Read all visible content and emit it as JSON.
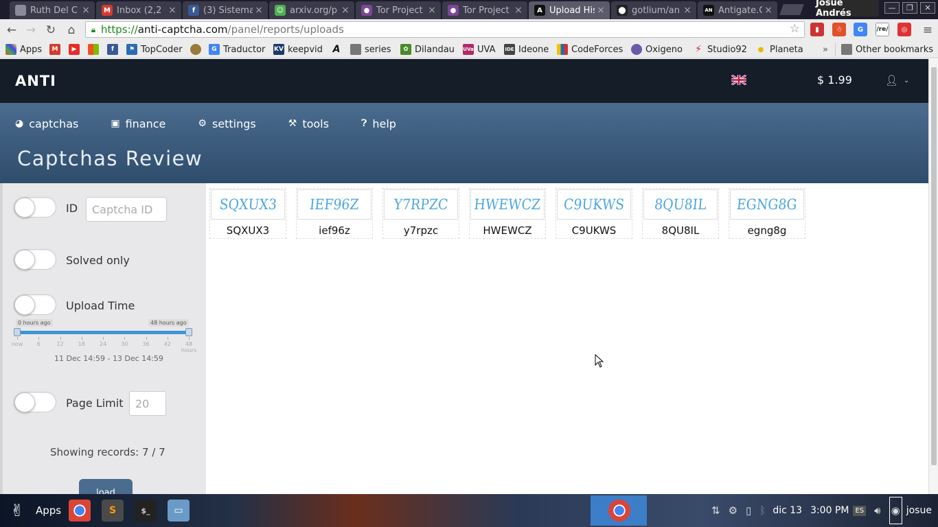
{
  "browser": {
    "tabs": [
      {
        "title": "Ruth Del C",
        "icon": "page",
        "color": "#8a8a9a"
      },
      {
        "title": "Inbox (2,2",
        "icon": "gmail",
        "color": "#d23b2f"
      },
      {
        "title": "(3) Sistema",
        "icon": "facebook",
        "color": "#3b5998"
      },
      {
        "title": "arxiv.org/p",
        "icon": "arxiv",
        "color": "#4caf50"
      },
      {
        "title": "Tor Project",
        "icon": "tor",
        "color": "#7d4698"
      },
      {
        "title": "Tor Project",
        "icon": "tor",
        "color": "#7d4698"
      },
      {
        "title": "Upload His",
        "icon": "anticaptcha",
        "color": "#111111"
      },
      {
        "title": "gotlium/an",
        "icon": "github",
        "color": "#222222"
      },
      {
        "title": "Antigate.C",
        "icon": "anti",
        "color": "#111111"
      }
    ],
    "profile_name": "Josué Andrés",
    "url": {
      "scheme": "https://",
      "host": "anti-captcha.com",
      "path": "/panel/reports/uploads"
    },
    "bookmarks": [
      {
        "label": "Apps",
        "icon": "apps-grid"
      },
      {
        "label": "",
        "icon": "gmail"
      },
      {
        "label": "",
        "icon": "youtube"
      },
      {
        "label": "",
        "icon": "windows"
      },
      {
        "label": "",
        "icon": "facebook"
      },
      {
        "label": "TopCoder",
        "icon": "topcoder"
      },
      {
        "label": "",
        "icon": "globe"
      },
      {
        "label": "Traductor",
        "icon": "translate"
      },
      {
        "label": "keepvid",
        "icon": "kv"
      },
      {
        "label": "",
        "icon": "font-a"
      },
      {
        "label": "series",
        "icon": "folder"
      },
      {
        "label": "Dilandau",
        "icon": "dilandau"
      },
      {
        "label": "UVA",
        "icon": "uva"
      },
      {
        "label": "Ideone",
        "icon": "ideone"
      },
      {
        "label": "CodeForces",
        "icon": "codeforces"
      },
      {
        "label": "Oxigeno",
        "icon": "oxigeno"
      },
      {
        "label": "Studio92",
        "icon": "studio92"
      },
      {
        "label": "Planeta",
        "icon": "planeta"
      }
    ],
    "other_bookmarks": "Other bookmarks",
    "overflow": "»"
  },
  "site": {
    "logo": "ANTI",
    "balance": "$ 1.99",
    "nav": [
      {
        "label": "captchas",
        "icon": "pie-icon"
      },
      {
        "label": "finance",
        "icon": "money-icon"
      },
      {
        "label": "settings",
        "icon": "gear-icon"
      },
      {
        "label": "tools",
        "icon": "tools-icon"
      },
      {
        "label": "help",
        "icon": "help-icon"
      }
    ],
    "page_title": "Captchas Review"
  },
  "filters": {
    "id_label": "ID",
    "id_placeholder": "Captcha ID",
    "solved_label": "Solved only",
    "upload_label": "Upload Time",
    "slider": {
      "left_tag": "0 hours ago",
      "right_tag": "48 hours ago",
      "scale": [
        "now",
        "6",
        "12",
        "18",
        "24",
        "30",
        "36",
        "42",
        "48"
      ],
      "scale_unit": "hours",
      "range_text": "11 Dec 14:59 - 13 Dec 14:59"
    },
    "page_limit_label": "Page Limit",
    "page_limit_value": "20",
    "records_text": "Showing records: 7 / 7",
    "load_button": "load"
  },
  "captchas": [
    {
      "image_text": "SQXUX3",
      "answer": "SQXUX3"
    },
    {
      "image_text": "IEF96Z",
      "answer": "ief96z"
    },
    {
      "image_text": "Y7RPZC",
      "answer": "y7rpzc"
    },
    {
      "image_text": "HWEWCZ",
      "answer": "HWEWCZ"
    },
    {
      "image_text": "C9UKWS",
      "answer": "C9UKWS"
    },
    {
      "image_text": "8QU8IL",
      "answer": "8QU8IL"
    },
    {
      "image_text": "EGNG8G",
      "answer": "egng8g"
    }
  ],
  "taskbar": {
    "apps_label": "Apps",
    "clock_date": "dic 13",
    "clock_time": "3:00 PM",
    "keyboard_layout": "ES",
    "user": "josue"
  },
  "colors": {
    "accent": "#4a6c8e",
    "topbar": "#151d29",
    "captcha_text": "#4aa6e0"
  }
}
